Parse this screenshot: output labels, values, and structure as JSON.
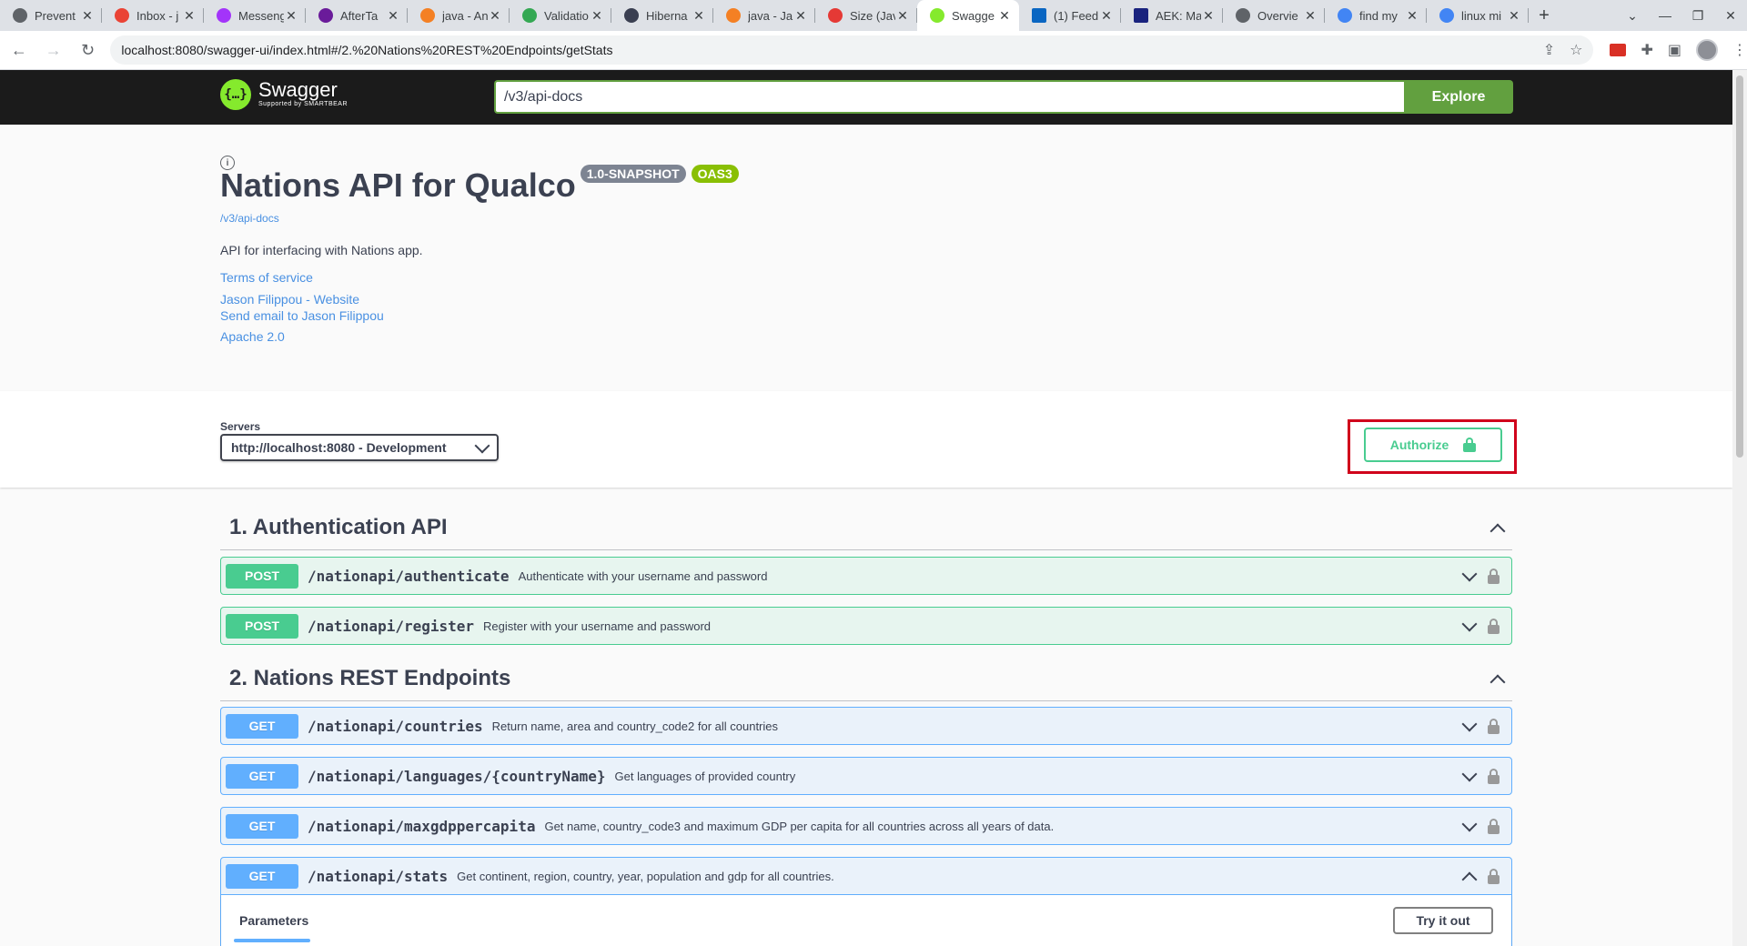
{
  "browser": {
    "tabs": [
      {
        "title": "Prevent",
        "color": "#5f6368",
        "active": false
      },
      {
        "title": "Inbox - j",
        "color": "#ea4335",
        "active": false
      },
      {
        "title": "Messeng",
        "color": "#a334fa",
        "active": false
      },
      {
        "title": "AfterTa",
        "color": "#6a1b9a",
        "active": false
      },
      {
        "title": "java - An",
        "color": "#f48024",
        "active": false
      },
      {
        "title": "Validatio",
        "color": "#34a853",
        "active": false
      },
      {
        "title": "Hiberna",
        "color": "#3a3f51",
        "active": false
      },
      {
        "title": "java - Ja",
        "color": "#f48024",
        "active": false
      },
      {
        "title": "Size (Jav",
        "color": "#e53935",
        "active": false
      },
      {
        "title": "Swagge",
        "color": "#85ea2d",
        "active": true
      },
      {
        "title": "(1) Feed",
        "color": "#0a66c2",
        "active": false
      },
      {
        "title": "AEK: Ma",
        "color": "#1a237e",
        "active": false
      },
      {
        "title": "Overvie",
        "color": "#5f6368",
        "active": false
      },
      {
        "title": "find my",
        "color": "#4285f4",
        "active": false
      },
      {
        "title": "linux mi",
        "color": "#4285f4",
        "active": false
      }
    ],
    "new_tab": "+",
    "url": "localhost:8080/swagger-ui/index.html#/2.%20Nations%20REST%20Endpoints/getStats"
  },
  "topbar": {
    "logo_text": "Swagger",
    "logo_sub": "Supported by SMARTBEAR",
    "spec_url": "/v3/api-docs",
    "explore_label": "Explore"
  },
  "info": {
    "title": "Nations API for Qualco",
    "version": "1.0-SNAPSHOT",
    "oas": "OAS3",
    "spec_link": "/v3/api-docs",
    "description": "API for interfacing with Nations app.",
    "terms": "Terms of service",
    "contact_website": "Jason Filippou - Website",
    "contact_email": "Send email to Jason Filippou",
    "license": "Apache 2.0"
  },
  "servers": {
    "label": "Servers",
    "selected": "http://localhost:8080 - Development"
  },
  "authorize_label": "Authorize",
  "tags": [
    {
      "name": "1. Authentication API",
      "operations": [
        {
          "method": "POST",
          "path": "/nationapi/authenticate",
          "summary": "Authenticate with your username and password"
        },
        {
          "method": "POST",
          "path": "/nationapi/register",
          "summary": "Register with your username and password"
        }
      ]
    },
    {
      "name": "2. Nations REST Endpoints",
      "operations": [
        {
          "method": "GET",
          "path": "/nationapi/countries",
          "summary": "Return name, area and country_code2 for all countries"
        },
        {
          "method": "GET",
          "path": "/nationapi/languages/{countryName}",
          "summary": "Get languages of provided country"
        },
        {
          "method": "GET",
          "path": "/nationapi/maxgdppercapita",
          "summary": "Get name, country_code3 and maximum GDP per capita for all countries across all years of data."
        },
        {
          "method": "GET",
          "path": "/nationapi/stats",
          "summary": "Get continent, region, country, year, population and gdp for all countries."
        }
      ]
    }
  ],
  "expanded": {
    "params_tab": "Parameters",
    "try_label": "Try it out"
  },
  "colors": {
    "post": "#49cc90",
    "get": "#61affe",
    "explore": "#62a03f",
    "highlight": "#d0021b"
  }
}
